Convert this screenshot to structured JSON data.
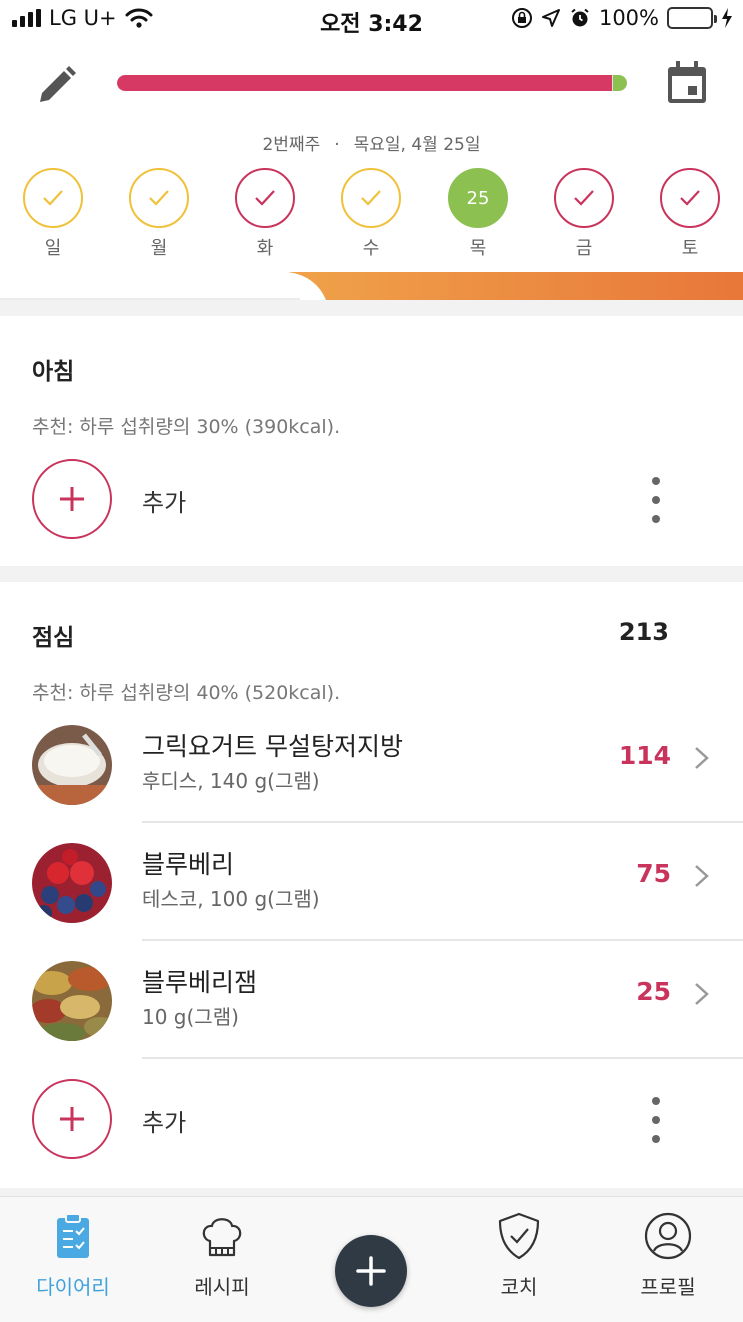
{
  "status_bar": {
    "carrier": "LG U+",
    "time": "오전 3:42",
    "battery": "100%"
  },
  "header": {
    "progress_fraction": 0.97,
    "week_label": "2번째주",
    "date_label": "목요일, 4월 25일",
    "days": [
      {
        "label": "일",
        "state": "done-yellow"
      },
      {
        "label": "월",
        "state": "done-yellow"
      },
      {
        "label": "화",
        "state": "done-red"
      },
      {
        "label": "수",
        "state": "done-yellow"
      },
      {
        "label": "목",
        "state": "today",
        "number": "25"
      },
      {
        "label": "금",
        "state": "done-red"
      },
      {
        "label": "토",
        "state": "done-red"
      }
    ]
  },
  "breakfast": {
    "title": "아침",
    "recommendation": "추천: 하루 섭취량의 30% (390kcal).",
    "add_label": "추가"
  },
  "lunch": {
    "title": "점심",
    "total": "213",
    "recommendation": "추천: 하루 섭취량의 40% (520kcal).",
    "items": [
      {
        "name": "그릭요거트 무설탕저지방",
        "detail": "후디스, 140 g(그램)",
        "kcal": "114",
        "image": "yogurt"
      },
      {
        "name": "블루베리",
        "detail": "테스코, 100 g(그램)",
        "kcal": "75",
        "image": "berries"
      },
      {
        "name": "블루베리잼",
        "detail": "10 g(그램)",
        "kcal": "25",
        "image": "spices"
      }
    ],
    "add_label": "추가"
  },
  "bottom_nav": {
    "items": [
      {
        "label": "다이어리",
        "icon": "clipboard-icon",
        "active": true
      },
      {
        "label": "레시피",
        "icon": "chef-hat-icon",
        "active": false
      },
      {
        "label": "코치",
        "icon": "shield-check-icon",
        "active": false
      },
      {
        "label": "프로필",
        "icon": "profile-icon",
        "active": false
      }
    ],
    "fab_icon": "plus-icon"
  },
  "colors": {
    "accent_red": "#c9345d",
    "progress_red": "#d63a64",
    "today_green": "#8cc152",
    "check_yellow": "#f0c13a",
    "nav_active": "#3fa2de",
    "orange": "#e8803a"
  }
}
